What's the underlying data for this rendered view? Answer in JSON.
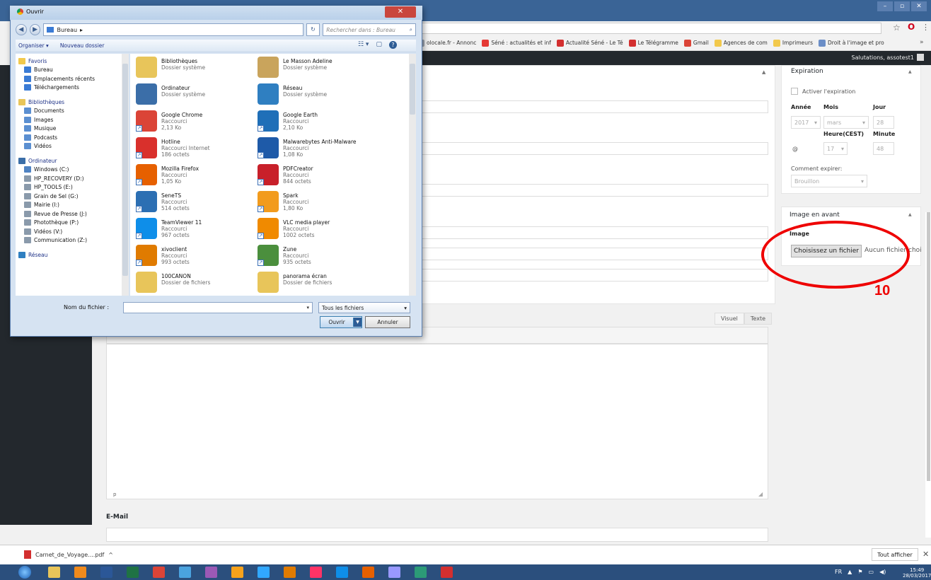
{
  "browser": {
    "bookmarks": [
      {
        "label": "olocale.fr - Annonc",
        "color": "#9ea7b3"
      },
      {
        "label": "Séné : actualités et inf",
        "color": "#e53935"
      },
      {
        "label": "Actualité Séné - Le Té",
        "color": "#d32f2f"
      },
      {
        "label": "Le Télégramme",
        "color": "#d32f2f"
      },
      {
        "label": "Gmail",
        "color": "#db4437"
      },
      {
        "label": "Agences de com",
        "color": "#f2c94c"
      },
      {
        "label": "Imprimeurs",
        "color": "#f2c94c"
      },
      {
        "label": "Droit à l'image et pro",
        "color": "#6b8ec7"
      }
    ],
    "more": "»",
    "greeting": "Salutations, assotest1",
    "star": "☆",
    "opera": "O",
    "menu": "⋮"
  },
  "dialog": {
    "title": "Ouvrir",
    "close": "✕",
    "back": "◀",
    "forward": "▶",
    "path": "Bureau",
    "path_arrow": "▸",
    "search_placeholder": "Rechercher dans : Bureau",
    "search_icon": "⌕",
    "refresh": "↻",
    "organize": "Organiser ▾",
    "new_folder": "Nouveau dossier",
    "view_icon": "☷ ▾",
    "pane_icon": "▢",
    "help_icon": "?",
    "nav": {
      "favorites_title": "Favoris",
      "favorites": [
        "Bureau",
        "Emplacements récents",
        "Téléchargements"
      ],
      "libraries_title": "Bibliothèques",
      "libraries": [
        "Documents",
        "Images",
        "Musique",
        "Podcasts",
        "Vidéos"
      ],
      "computer_title": "Ordinateur",
      "drives": [
        "Windows (C:)",
        "HP_RECOVERY (D:)",
        "HP_TOOLS (E:)",
        "Grain de Sel (G:)",
        "Mairie (I:)",
        "Revue de Presse (J:)",
        "Photothèque (P:)",
        "Vidéos (V:)",
        "Communication (Z:)"
      ],
      "network_title": "Réseau"
    },
    "files": [
      {
        "name": "Bibliothèques",
        "line2": "Dossier système",
        "line3": "",
        "color": "#e8c55a",
        "shortcut": false
      },
      {
        "name": "Le Masson Adeline",
        "line2": "Dossier système",
        "line3": "",
        "color": "#c9a45c",
        "shortcut": false
      },
      {
        "name": "Ordinateur",
        "line2": "Dossier système",
        "line3": "",
        "color": "#3b6ea8",
        "shortcut": false
      },
      {
        "name": "Réseau",
        "line2": "Dossier système",
        "line3": "",
        "color": "#2f7fc1",
        "shortcut": false
      },
      {
        "name": "Google Chrome",
        "line2": "Raccourci",
        "line3": "2,13 Ko",
        "color": "#db4437",
        "shortcut": true
      },
      {
        "name": "Google Earth",
        "line2": "Raccourci",
        "line3": "2,10 Ko",
        "color": "#1f6fb8",
        "shortcut": true
      },
      {
        "name": "Hotline",
        "line2": "Raccourci Internet",
        "line3": "186 octets",
        "color": "#d9302c",
        "shortcut": true
      },
      {
        "name": "Malwarebytes Anti-Malware",
        "line2": "Raccourci",
        "line3": "1,08 Ko",
        "color": "#1e5aa8",
        "shortcut": true
      },
      {
        "name": "Mozilla Firefox",
        "line2": "Raccourci",
        "line3": "1,05 Ko",
        "color": "#e66000",
        "shortcut": true
      },
      {
        "name": "PDFCreator",
        "line2": "Raccourci",
        "line3": "844 octets",
        "color": "#c8202a",
        "shortcut": true
      },
      {
        "name": "SeneTS",
        "line2": "Raccourci",
        "line3": "514 octets",
        "color": "#2c6fb3",
        "shortcut": true
      },
      {
        "name": "Spark",
        "line2": "Raccourci",
        "line3": "1,80 Ko",
        "color": "#f29b1d",
        "shortcut": true
      },
      {
        "name": "TeamViewer 11",
        "line2": "Raccourci",
        "line3": "967 octets",
        "color": "#0e8ee9",
        "shortcut": true
      },
      {
        "name": "VLC media player",
        "line2": "Raccourci",
        "line3": "1002 octets",
        "color": "#f08a00",
        "shortcut": true
      },
      {
        "name": "xivoclient",
        "line2": "Raccourci",
        "line3": "993 octets",
        "color": "#e07b00",
        "shortcut": true
      },
      {
        "name": "Zune",
        "line2": "Raccourci",
        "line3": "935 octets",
        "color": "#4b8f3d",
        "shortcut": true
      },
      {
        "name": "100CANON",
        "line2": "Dossier de fichiers",
        "line3": "",
        "color": "#e8c55a",
        "shortcut": false
      },
      {
        "name": "panorama écran",
        "line2": "Dossier de fichiers",
        "line3": "",
        "color": "#e8c55a",
        "shortcut": false
      }
    ],
    "filename_label": "Nom du fichier :",
    "filename_value": "",
    "dropdown_arrow": "▾",
    "filetype": "Tous les fichiers",
    "open": "Ouvrir",
    "cancel": "Annuler"
  },
  "editor": {
    "tab_visual": "Visuel",
    "tab_text": "Texte",
    "status_p": "p",
    "email_label": "E-Mail"
  },
  "sidebar": {
    "expiration": {
      "title": "Expiration",
      "toggle": "▲",
      "checkbox_label": "Activer l'expiration",
      "year_label": "Année",
      "month_label": "Mois",
      "day_label": "Jour",
      "year": "2017",
      "month": "mars",
      "day": "28",
      "hour_label": "Heure(CEST)",
      "minute_label": "Minute",
      "hour": "17",
      "minute": "48",
      "at_symbol": "@",
      "how_label": "Comment expirer:",
      "how_value": "Brouillon"
    },
    "featured": {
      "title": "Image en avant",
      "toggle": "▲",
      "image_label": "Image",
      "choose_button": "Choisissez un fichier",
      "no_file": "Aucun fichier choisi"
    }
  },
  "annotation": {
    "step": "10",
    "color": "#e00000"
  },
  "downloads": {
    "file": "Carnet_de_Voyage....pdf",
    "chevron": "^",
    "show_all": "Tout afficher",
    "close": "✕"
  },
  "taskbar": {
    "apps": [
      {
        "name": "explorer",
        "color": "#e8c55a"
      },
      {
        "name": "outlook",
        "color": "#f08a1c"
      },
      {
        "name": "word",
        "color": "#2b5797"
      },
      {
        "name": "excel-like",
        "color": "#1f7244"
      },
      {
        "name": "chrome",
        "color": "#db4437"
      },
      {
        "name": "media",
        "color": "#4aa3df"
      },
      {
        "name": "colors",
        "color": "#9b59b6"
      },
      {
        "name": "illustrator",
        "color": "#f7a21b"
      },
      {
        "name": "photoshop",
        "color": "#31a8ff"
      },
      {
        "name": "xivo",
        "color": "#e07b00"
      },
      {
        "name": "indesign",
        "color": "#ff3366"
      },
      {
        "name": "teamviewer",
        "color": "#0e8ee9"
      },
      {
        "name": "firefox",
        "color": "#e66000"
      },
      {
        "name": "premiere",
        "color": "#9999ff"
      },
      {
        "name": "publisher",
        "color": "#2c9b77"
      },
      {
        "name": "acrobat",
        "color": "#d32f2f"
      }
    ],
    "lang": "FR",
    "time": "15:49",
    "date": "28/03/2017"
  }
}
